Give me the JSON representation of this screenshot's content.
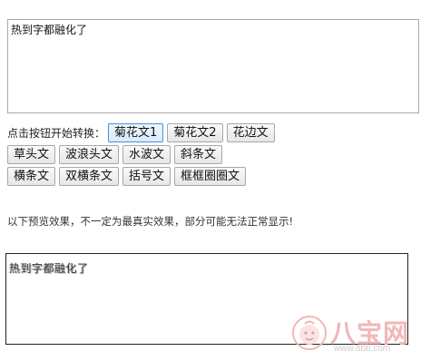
{
  "input": {
    "value": "热到字都融化了"
  },
  "controls": {
    "prompt": "点击按钮开始转换：",
    "row1": [
      "菊花文1",
      "菊花文2",
      "花边文"
    ],
    "row2": [
      "草头文",
      "波浪头文",
      "水波文",
      "斜条文"
    ],
    "row3": [
      "横条文",
      "双横条文",
      "括号文",
      "框框圈圈文"
    ]
  },
  "note": "以下预览效果，不一定为最真实效果，部分可能无法正常显示!",
  "preview": {
    "text": "热到字都融化了"
  },
  "watermark": {
    "brand": "八宝网",
    "url": "www.8bb.com"
  },
  "colors": {
    "active_border": "#4a90d9",
    "watermark": "#f1b7b7"
  }
}
